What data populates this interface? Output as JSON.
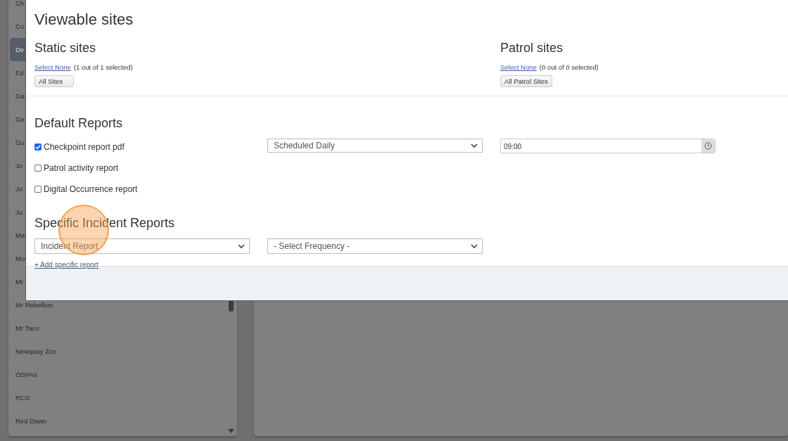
{
  "sidebar": {
    "items": [
      {
        "label": "Ch",
        "selected": false
      },
      {
        "label": "Co",
        "selected": false
      },
      {
        "label": "De",
        "selected": true
      },
      {
        "label": "Ed",
        "selected": false
      },
      {
        "label": "Ga",
        "selected": false
      },
      {
        "label": "Ge",
        "selected": false
      },
      {
        "label": "Gu",
        "selected": false
      },
      {
        "label": "Jo",
        "selected": false
      },
      {
        "label": "Jo",
        "selected": false
      },
      {
        "label": "Ju",
        "selected": false
      },
      {
        "label": "Ma",
        "selected": false
      },
      {
        "label": "Mo",
        "selected": false
      },
      {
        "label": "Mr",
        "selected": false
      },
      {
        "label": "Mr Rebellion",
        "selected": false
      },
      {
        "label": "Mr Taco",
        "selected": false
      },
      {
        "label": "Newquay Zoo",
        "selected": false
      },
      {
        "label": "OSPAs",
        "selected": false
      },
      {
        "label": "RCS",
        "selected": false
      },
      {
        "label": "Red Dawn",
        "selected": false
      }
    ]
  },
  "modal": {
    "title": "Viewable sites",
    "site_groups": [
      {
        "heading": "Static sites",
        "link": "Select None",
        "count": "(1 out of 1 selected)",
        "button": "All Sites"
      },
      {
        "heading": "Patrol sites",
        "link": "Select None",
        "count": "(0 out of 0 selected)",
        "button": "All Patrol Sites"
      }
    ],
    "default_reports": {
      "heading": "Default Reports",
      "reports": [
        {
          "label": "Checkpoint report pdf",
          "checked": true
        },
        {
          "label": "Patrol activity report",
          "checked": false
        },
        {
          "label": "Digital Occurrence report",
          "checked": false
        }
      ],
      "frequency_select": {
        "value": "Scheduled Daily"
      },
      "time_input": {
        "value": "09:00"
      }
    },
    "specific_reports": {
      "heading": "Specific Incident Reports",
      "report_select": {
        "value": "Incident Report"
      },
      "frequency_select": {
        "value": "- Select Frequency -"
      },
      "add_link": "+ Add specific report"
    }
  }
}
